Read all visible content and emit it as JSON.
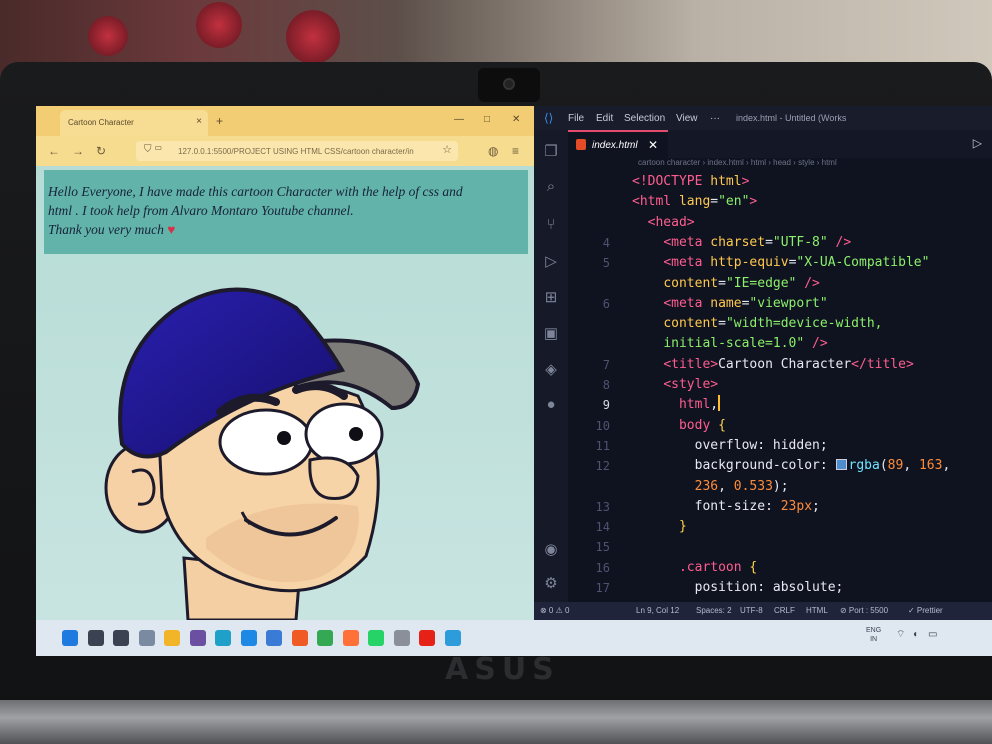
{
  "browser": {
    "tab_title": "Cartoon Character",
    "tab_close": "×",
    "new_tab": "+",
    "window_controls": [
      "—",
      "□",
      "✕"
    ],
    "nav_icons": [
      "arrow-left-icon",
      "arrow-right-icon",
      "reload-icon"
    ],
    "url": "127.0.0.1:5500/PROJECT USING HTML CSS/cartoon character/in",
    "page_intro_line1": "Hello Everyone, I have made this cartoon Character with the help of css and",
    "page_intro_line2": "html . I took help from Alvaro Montaro Youtube channel.",
    "page_intro_line3": "Thank you very much",
    "intro_bg": "#62b3a9",
    "page_bg": "#c6e3e2"
  },
  "vscode": {
    "menu": [
      "File",
      "Edit",
      "Selection",
      "View",
      "···"
    ],
    "window_title": "index.html - Untitled (Works",
    "active_tab": "index.html",
    "breadcrumb": "cartoon character  ›  index.html  ›  html  ›  head  ›  style  ›  html",
    "code_lines": [
      {
        "n": "",
        "html": "<span class='tok-tag'>&lt;!DOCTYPE</span> <span class='tok-attr'>html</span><span class='tok-tag'>&gt;</span>"
      },
      {
        "n": "",
        "html": "<span class='tok-tag'>&lt;html</span> <span class='tok-attr'>lang</span><span class='tok-txt'>=</span><span class='tok-str'>\"en\"</span><span class='tok-tag'>&gt;</span>"
      },
      {
        "n": "",
        "html": "  <span class='tok-tag'>&lt;head&gt;</span>"
      },
      {
        "n": "4",
        "html": "    <span class='tok-tag'>&lt;meta</span> <span class='tok-attr'>charset</span><span class='tok-txt'>=</span><span class='tok-str'>\"UTF-8\"</span> <span class='tok-tag'>/&gt;</span>"
      },
      {
        "n": "5",
        "html": "    <span class='tok-tag'>&lt;meta</span> <span class='tok-attr'>http-equiv</span><span class='tok-txt'>=</span><span class='tok-str'>\"X-UA-Compatible\"</span>"
      },
      {
        "n": "",
        "html": "    <span class='tok-attr'>content</span><span class='tok-txt'>=</span><span class='tok-str'>\"IE=edge\"</span> <span class='tok-tag'>/&gt;</span>"
      },
      {
        "n": "6",
        "html": "    <span class='tok-tag'>&lt;meta</span> <span class='tok-attr'>name</span><span class='tok-txt'>=</span><span class='tok-str'>\"viewport\"</span>"
      },
      {
        "n": "",
        "html": "    <span class='tok-attr'>content</span><span class='tok-txt'>=</span><span class='tok-str'>\"width=device-width,</span>"
      },
      {
        "n": "",
        "html": "    <span class='tok-str'>initial-scale=1.0\"</span> <span class='tok-tag'>/&gt;</span>"
      },
      {
        "n": "7",
        "html": "    <span class='tok-tag'>&lt;title&gt;</span><span class='tok-txt'>Cartoon Character</span><span class='tok-tag'>&lt;/title&gt;</span>"
      },
      {
        "n": "8",
        "html": "    <span class='tok-tag'>&lt;style&gt;</span>"
      },
      {
        "n": "9",
        "html": "      <span class='tok-sel'>html</span><span class='tok-txt'>,</span><span class='cursor'></span>",
        "active": true
      },
      {
        "n": "10",
        "html": "      <span class='tok-sel'>body</span> <span class='tok-brace'>{</span>"
      },
      {
        "n": "11",
        "html": "        <span class='tok-prop'>overflow</span><span class='tok-txt'>: hidden;</span>"
      },
      {
        "n": "12",
        "html": "        <span class='tok-prop'>background-color</span><span class='tok-txt'>: </span><span class='v-swatch'></span><span class='tok-fn'>rgba</span><span class='tok-txt'>(</span><span class='tok-num'>89</span><span class='tok-txt'>, </span><span class='tok-num'>163</span><span class='tok-txt'>,</span>"
      },
      {
        "n": "",
        "html": "        <span class='tok-num'>236</span><span class='tok-txt'>, </span><span class='tok-num'>0.533</span><span class='tok-txt'>);</span>"
      },
      {
        "n": "13",
        "html": "        <span class='tok-prop'>font-size</span><span class='tok-txt'>: </span><span class='tok-num'>23px</span><span class='tok-txt'>;</span>"
      },
      {
        "n": "14",
        "html": "      <span class='tok-brace'>}</span>"
      },
      {
        "n": "15",
        "html": ""
      },
      {
        "n": "16",
        "html": "      <span class='tok-sel'>.cartoon</span> <span class='tok-brace'>{</span>"
      },
      {
        "n": "17",
        "html": "        <span class='tok-prop'>position</span><span class='tok-txt'>: absolute;</span>"
      }
    ],
    "status": {
      "problems": "⊗ 0 ⚠ 0",
      "position": "Ln 9, Col 12",
      "spaces": "Spaces: 2",
      "encoding": "UTF-8",
      "eol": "CRLF",
      "language": "HTML",
      "port": "⊘ Port : 5500",
      "prettier": "✓ Prettier"
    }
  },
  "taskbar": {
    "icons": [
      {
        "name": "windows-start-icon",
        "color": "#1f7ae0"
      },
      {
        "name": "search-icon",
        "color": "#3b4252"
      },
      {
        "name": "task-view-icon",
        "color": "#3b4252"
      },
      {
        "name": "notepad-icon",
        "color": "#7a8aa0"
      },
      {
        "name": "file-explorer-icon",
        "color": "#f2b52a"
      },
      {
        "name": "github-desktop-icon",
        "color": "#6b4fa0"
      },
      {
        "name": "edge-icon",
        "color": "#1fa0c8"
      },
      {
        "name": "vscode-icon",
        "color": "#1e88e5"
      },
      {
        "name": "photos-icon",
        "color": "#3a7bd5"
      },
      {
        "name": "brave-icon",
        "color": "#f05a24"
      },
      {
        "name": "chrome-icon",
        "color": "#34a853"
      },
      {
        "name": "firefox-icon",
        "color": "#ff7139"
      },
      {
        "name": "whatsapp-icon",
        "color": "#25d366"
      },
      {
        "name": "mail-icon",
        "color": "#8a8f99"
      },
      {
        "name": "youtube-icon",
        "color": "#e62117"
      },
      {
        "name": "app-icon",
        "color": "#2d9cdb"
      }
    ],
    "lang_top": "ENG",
    "lang_bottom": "IN"
  }
}
